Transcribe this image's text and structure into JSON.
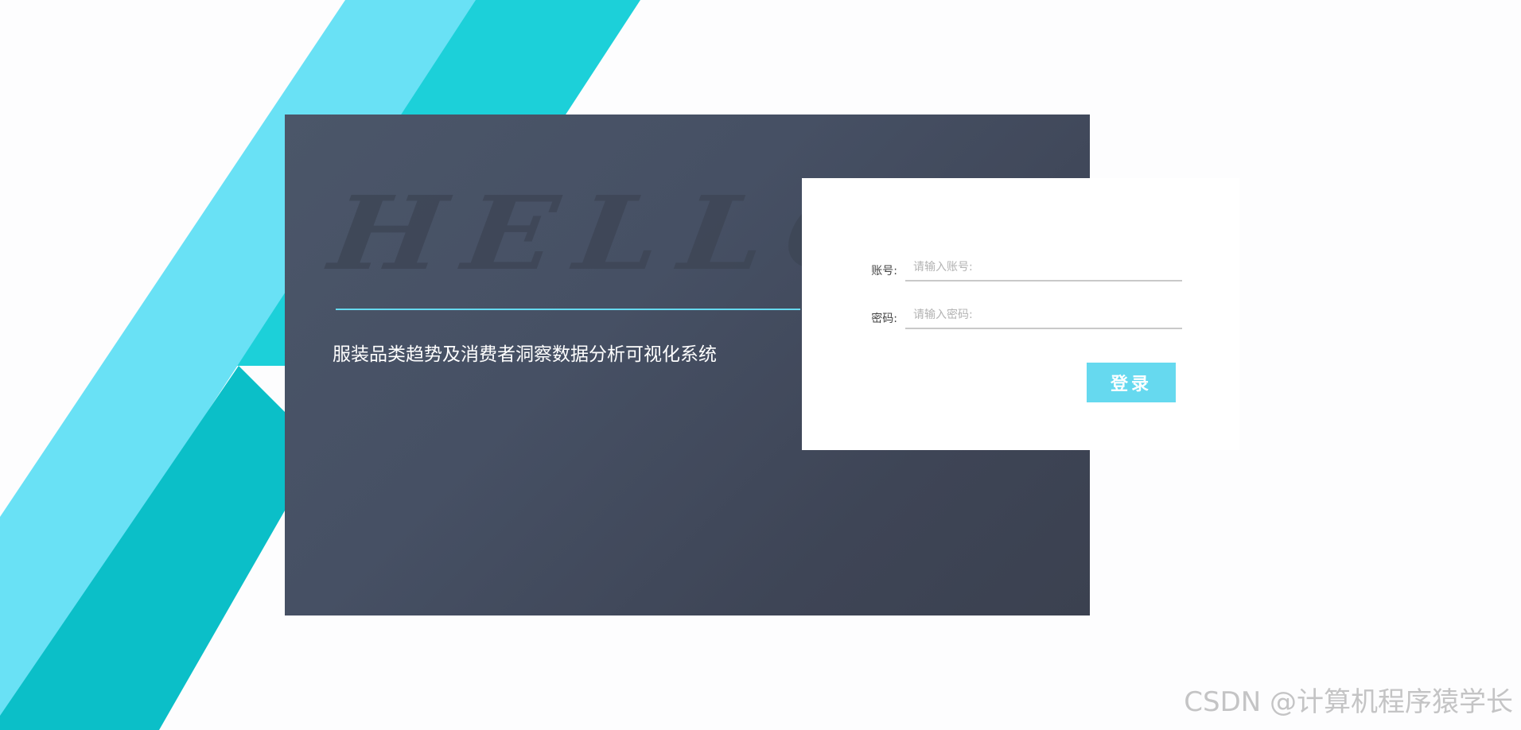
{
  "hero": {
    "hello": "HELLO",
    "system_title": "服装品类趋势及消费者洞察数据分析可视化系统"
  },
  "login_form": {
    "account_label": "账号:",
    "account_placeholder": "请输入账号:",
    "account_value": "",
    "password_label": "密码:",
    "password_placeholder": "请输入密码:",
    "password_value": "",
    "login_button": "登录"
  },
  "watermark": "CSDN @计算机程序猿学长",
  "colors": {
    "accent": "#66d9ef",
    "stripe_light": "#69e1f5",
    "stripe_dark": "#1cd0d9",
    "stripe_darker": "#0bbfc8",
    "panel": "#465064"
  }
}
